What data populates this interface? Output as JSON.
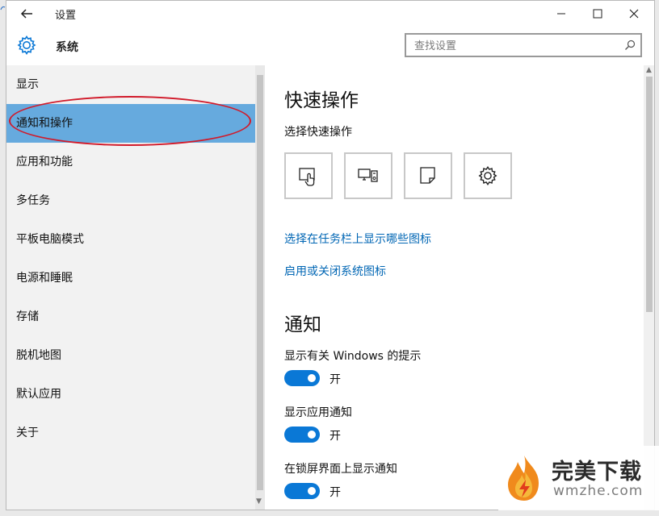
{
  "window": {
    "title": "设置"
  },
  "header": {
    "title": "系统",
    "search_placeholder": "查找设置"
  },
  "sidebar": {
    "items": [
      {
        "label": "显示"
      },
      {
        "label": "通知和操作",
        "active": true
      },
      {
        "label": "应用和功能"
      },
      {
        "label": "多任务"
      },
      {
        "label": "平板电脑模式"
      },
      {
        "label": "电源和睡眠"
      },
      {
        "label": "存储"
      },
      {
        "label": "脱机地图"
      },
      {
        "label": "默认应用"
      },
      {
        "label": "关于"
      }
    ]
  },
  "main": {
    "quick_actions_heading": "快速操作",
    "quick_actions_sublabel": "选择快速操作",
    "quick_action_icons": [
      "tablet-mode-icon",
      "connect-display-icon",
      "note-icon",
      "settings-gear-icon"
    ],
    "links": [
      "选择在任务栏上显示哪些图标",
      "启用或关闭系统图标"
    ],
    "notifications_heading": "通知",
    "toggles": [
      {
        "label": "显示有关 Windows 的提示",
        "state": "开",
        "on": true
      },
      {
        "label": "显示应用通知",
        "state": "开",
        "on": true
      },
      {
        "label": "在锁屏界面上显示通知",
        "state": "开",
        "on": true
      }
    ]
  },
  "watermark": {
    "title": "完美下载",
    "domain": "wmzhe.com"
  },
  "colors": {
    "accent": "#0a78d6",
    "sidebar_active": "#66aade",
    "link": "#0066b4",
    "highlight_ring": "#d11a2a"
  }
}
